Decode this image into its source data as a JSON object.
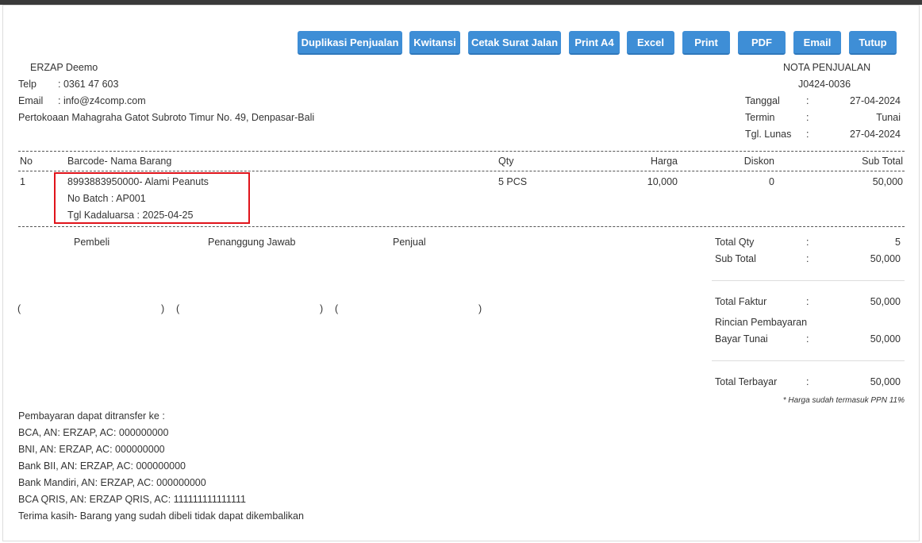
{
  "toolbar": [
    "Duplikasi Penjualan",
    "Kwitansi",
    "Cetak Surat Jalan",
    "Print A4",
    "Excel",
    "Print",
    "PDF",
    "Email",
    "Tutup"
  ],
  "company": {
    "name": "ERZAP Deemo",
    "phone_label": "Telp",
    "phone": ": 0361 47 603",
    "email_label": "Email",
    "email": ": info@z4comp.com",
    "address": "Pertokoaan Mahagraha Gatot Subroto Timur No. 49, Denpasar-Bali"
  },
  "invoice": {
    "title": "NOTA PENJUALAN",
    "number": "J0424-0036",
    "colon": ":",
    "date_label": "Tanggal",
    "date": "27-04-2024",
    "term_label": "Termin",
    "term": "Tunai",
    "paid_label": "Tgl. Lunas",
    "paid_date": "27-04-2024"
  },
  "table": {
    "headers": [
      "No",
      "Barcode- Nama Barang",
      "Qty",
      "Harga",
      "Diskon",
      "Sub Total"
    ],
    "rows": [
      {
        "no": "1",
        "item": "8993883950000- Alami Peanuts",
        "batch": "No Batch : AP001",
        "expiry": "Tgl Kadaluarsa : 2025-04-25",
        "qty": "5 PCS",
        "price": "10,000",
        "discount": "0",
        "subtotal": "50,000"
      }
    ]
  },
  "signatures": [
    "Pembeli",
    "Penanggung Jawab",
    "Penjual"
  ],
  "brackets": {
    "open": "(",
    "close": ")"
  },
  "summary": {
    "total_qty_label": "Total Qty",
    "total_qty": "5",
    "sub_total_label": "Sub Total",
    "sub_total": "50,000",
    "total_faktur_label": "Total Faktur",
    "total_faktur": "50,000",
    "payment_details_label": "Rincian Pembayaran",
    "cash_label": "Bayar Tunai",
    "cash": "50,000",
    "total_paid_label": "Total Terbayar",
    "total_paid": "50,000",
    "tax_note": "* Harga sudah termasuk PPN 11%"
  },
  "footer": {
    "lines": [
      "Pembayaran dapat ditransfer ke :",
      "BCA, AN: ERZAP, AC: 000000000",
      "BNI, AN: ERZAP, AC: 000000000",
      "Bank BII, AN: ERZAP, AC: 000000000",
      "Bank Mandiri, AN: ERZAP, AC: 000000000",
      "BCA QRIS, AN: ERZAP QRIS, AC: 111111111111111",
      "Terima kasih- Barang yang sudah dibeli tidak dapat dikembalikan"
    ]
  },
  "colors": {
    "button": "#3e8ed6",
    "highlight": "#e0141b",
    "text": "#333333"
  }
}
